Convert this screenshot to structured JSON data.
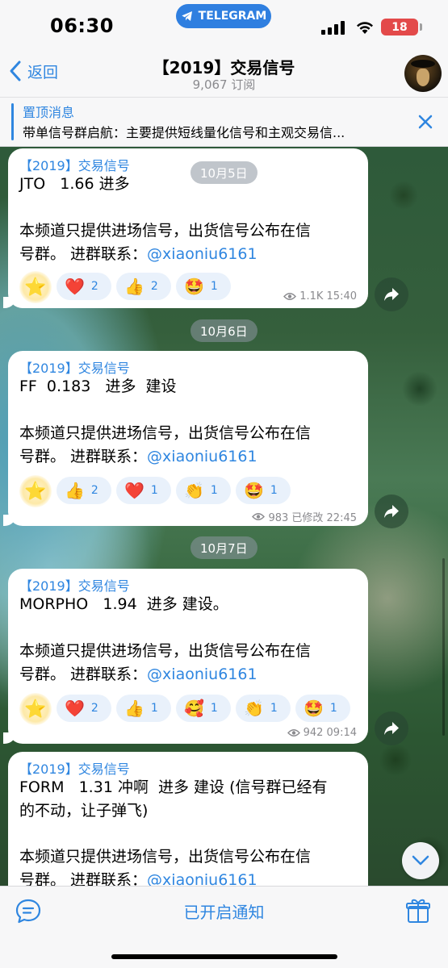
{
  "status": {
    "time": "06:30",
    "app_pill": "TELEGRAM",
    "battery": "18"
  },
  "header": {
    "back": "返回",
    "title": "【2019】交易信号",
    "subtitle": "9,067 订阅"
  },
  "pinned": {
    "label": "置顶消息",
    "text": "带单信号群启航：主要提供短线量化信号和主观交易信..."
  },
  "dates": [
    "10月5日",
    "10月6日",
    "10月7日"
  ],
  "messages": [
    {
      "sender": "【2019】交易信号",
      "line1": "JTO   1.66 进多",
      "body": "本频道只提供进场信号，出货信号公布在信\n号群。 进群联系：",
      "link": "@xiaoniu6161",
      "reactions": [
        {
          "emoji": "❤️",
          "count": "2"
        },
        {
          "emoji": "👍",
          "count": "2"
        },
        {
          "emoji": "🤩",
          "count": "1"
        }
      ],
      "meta": "1.1K 15:40"
    },
    {
      "sender": "【2019】交易信号",
      "line1": "FF  0.183   进多  建设",
      "body": "本频道只提供进场信号，出货信号公布在信\n号群。 进群联系：",
      "link": "@xiaoniu6161",
      "reactions": [
        {
          "emoji": "👍",
          "count": "2"
        },
        {
          "emoji": "❤️",
          "count": "1"
        },
        {
          "emoji": "👏",
          "count": "1"
        },
        {
          "emoji": "🤩",
          "count": "1"
        }
      ],
      "meta": "983 已修改 22:45"
    },
    {
      "sender": "【2019】交易信号",
      "line1": "MORPHO   1.94  进多 建设。",
      "body": "本频道只提供进场信号，出货信号公布在信\n号群。 进群联系：",
      "link": "@xiaoniu6161",
      "reactions": [
        {
          "emoji": "❤️",
          "count": "2"
        },
        {
          "emoji": "👍",
          "count": "1"
        },
        {
          "emoji": "🥰",
          "count": "1"
        },
        {
          "emoji": "👏",
          "count": "1"
        },
        {
          "emoji": "🤩",
          "count": "1"
        }
      ],
      "meta": "942 09:14"
    },
    {
      "sender": "【2019】交易信号",
      "line1": "FORM   1.31 冲啊  进多 建设 (信号群已经有\n的不动，让子弹飞)",
      "body": "本频道只提供进场信号，出货信号公布在信\n号群。 进群联系：",
      "link": "@xiaoniu6161"
    }
  ],
  "star_reaction": "⭐",
  "bottom": {
    "notify": "已开启通知"
  },
  "colors": {
    "accent": "#2f86e0",
    "battery": "#e34a4a"
  }
}
